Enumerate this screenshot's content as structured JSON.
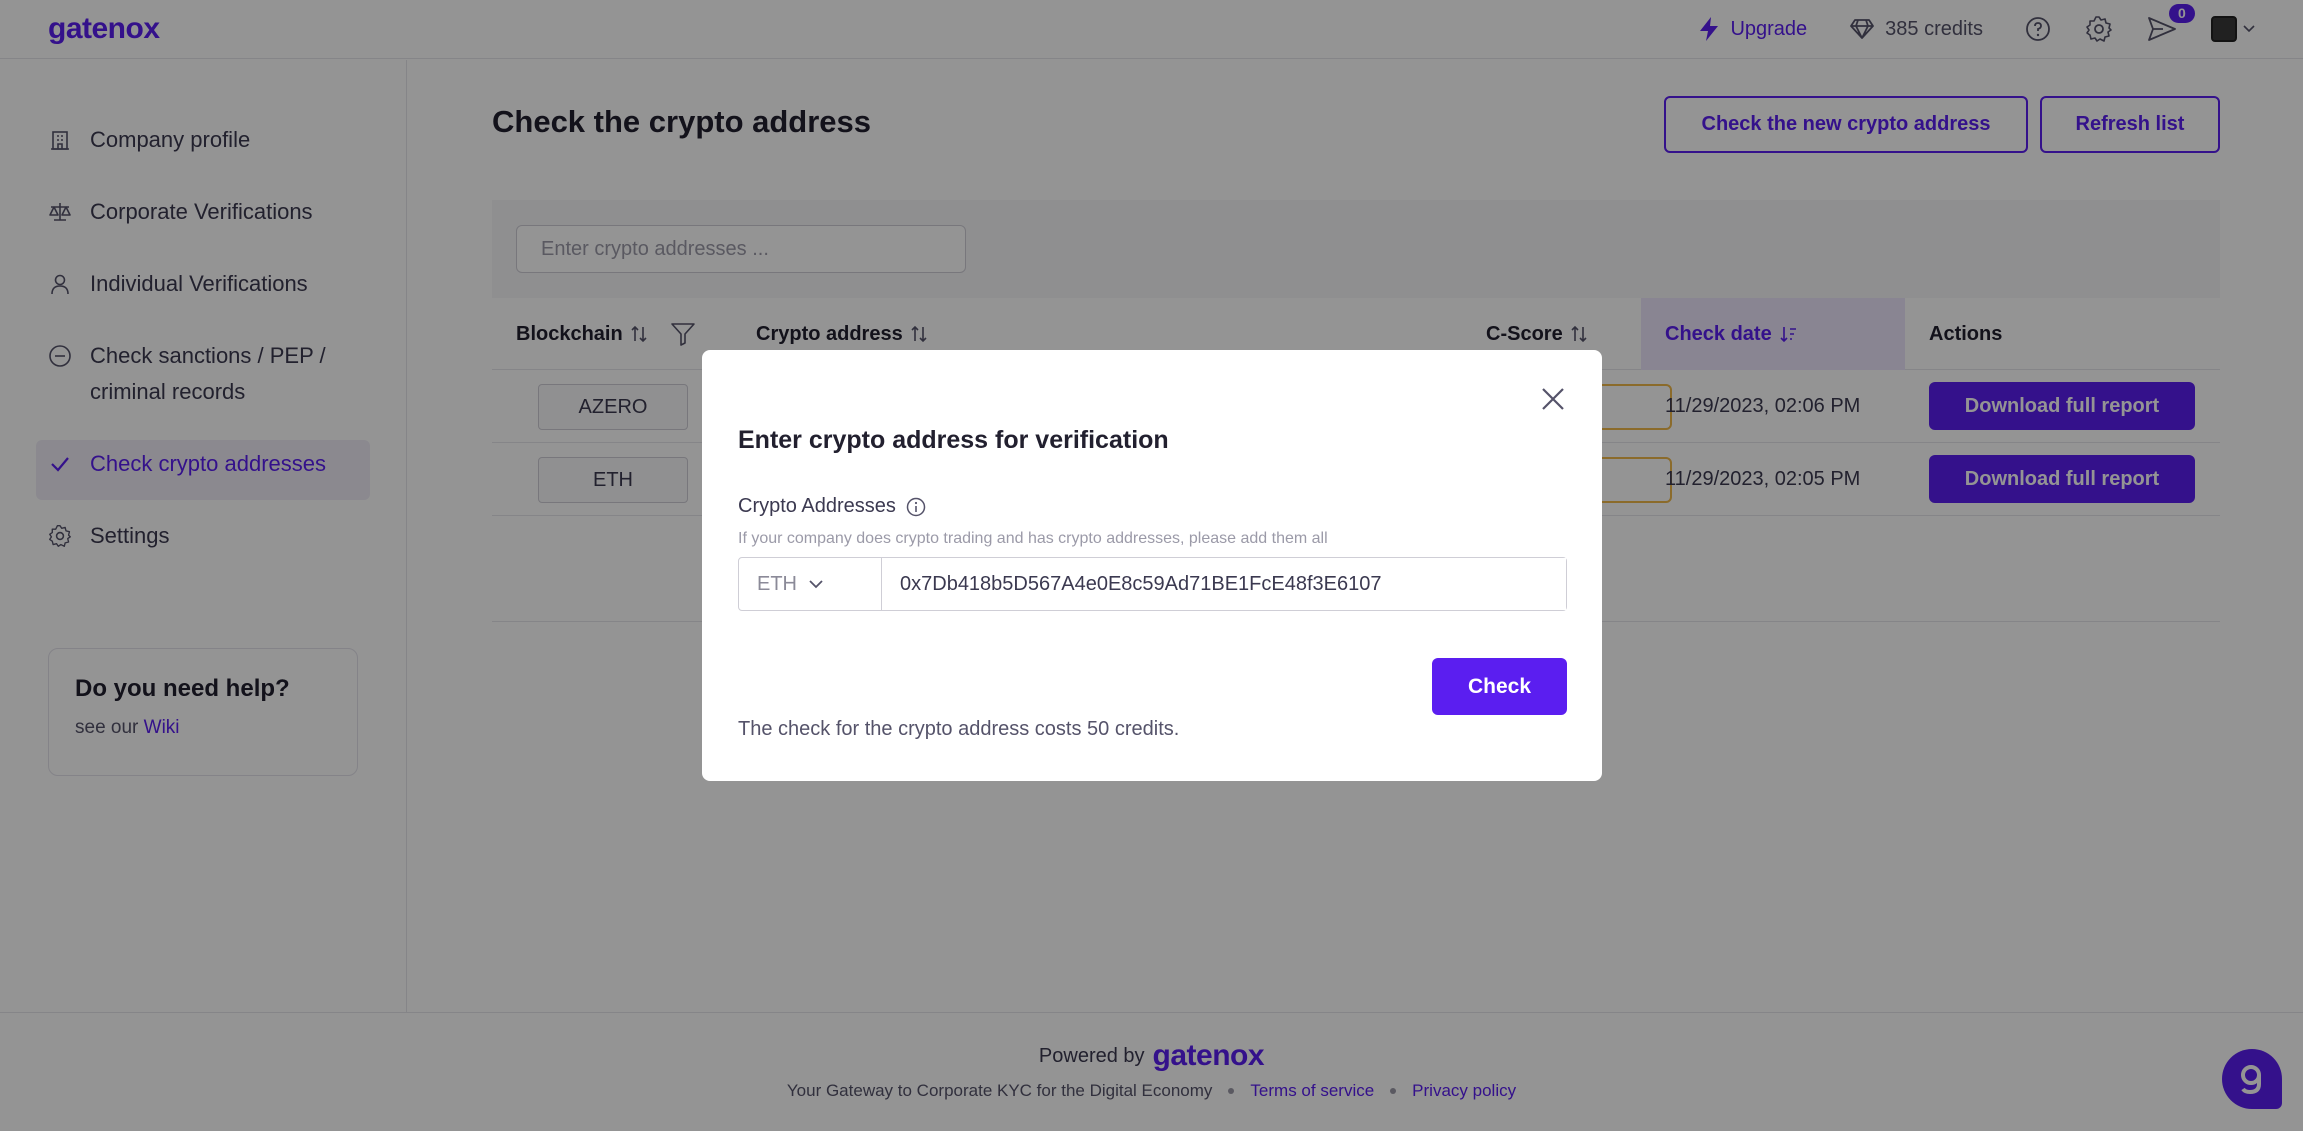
{
  "app": {
    "logo": "gatenox"
  },
  "topbar": {
    "upgrade_label": "Upgrade",
    "credits_label": "385 credits",
    "notifications_count": "0"
  },
  "sidebar": {
    "items": [
      {
        "label": "Company profile",
        "icon": "building-icon",
        "active": false
      },
      {
        "label": "Corporate Verifications",
        "icon": "scales-icon",
        "active": false
      },
      {
        "label": "Individual Verifications",
        "icon": "person-icon",
        "active": false
      },
      {
        "label": "Check sanctions / PEP / criminal records",
        "icon": "minus-circle-icon",
        "active": false
      },
      {
        "label": "Check crypto addresses",
        "icon": "check-icon",
        "active": true
      },
      {
        "label": "Settings",
        "icon": "gear-icon",
        "active": false
      }
    ],
    "help": {
      "title": "Do you need help?",
      "prefix": "see our",
      "link": "Wiki"
    }
  },
  "main": {
    "title": "Check the crypto address",
    "check_new_label": "Check the new crypto address",
    "refresh_label": "Refresh list",
    "search_placeholder": "Enter crypto addresses ...",
    "columns": [
      "Blockchain",
      "Crypto address",
      "C-Score",
      "Check date",
      "Actions"
    ],
    "rows": [
      {
        "blockchain": "AZERO",
        "check_date": "11/29/2023, 02:06 PM",
        "action": "Download full report"
      },
      {
        "blockchain": "ETH",
        "check_date": "11/29/2023, 02:05 PM",
        "action": "Download full report"
      }
    ]
  },
  "modal": {
    "title": "Enter crypto address for verification",
    "field_label": "Crypto Addresses",
    "field_hint": "If your company does crypto trading and has crypto addresses, please add them all",
    "chain_value": "ETH",
    "address_value": "0x7Db418b5D567A4e0E8c59Ad71BE1FcE48f3E6107",
    "check_label": "Check",
    "cost_text": "The check for the crypto address costs 50 credits."
  },
  "footer": {
    "powered_by": "Powered by",
    "logo": "gatenox",
    "tagline": "Your Gateway to Corporate KYC for the Digital Economy",
    "terms": "Terms of service",
    "privacy": "Privacy policy"
  },
  "colors": {
    "accent": "#5b1ef0",
    "warning": "#f0b84a"
  }
}
